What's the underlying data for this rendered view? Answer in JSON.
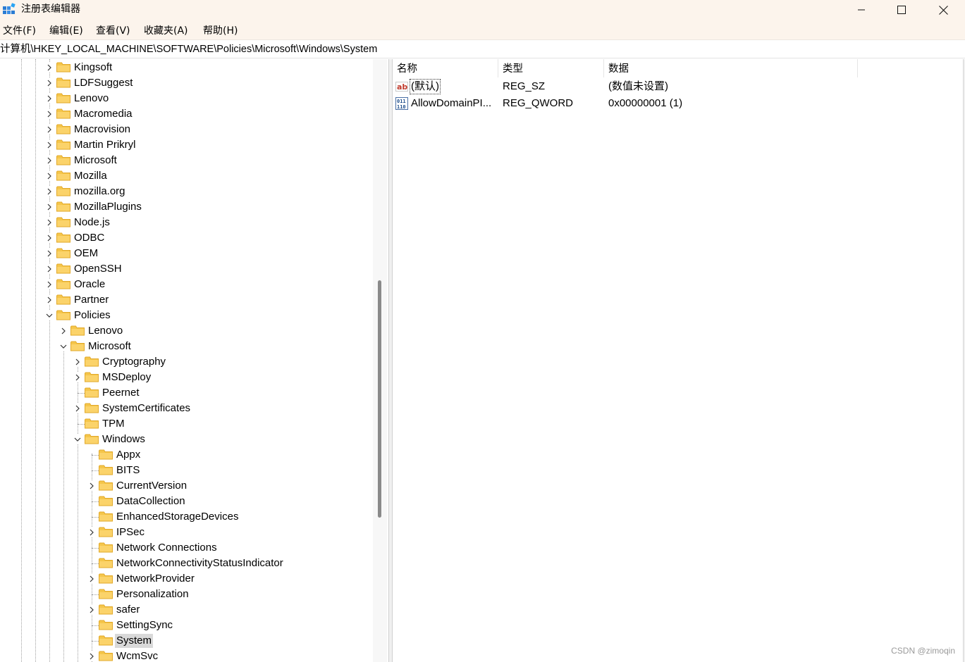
{
  "window": {
    "title": "注册表编辑器",
    "minimize_icon": "minimize-icon",
    "maximize_icon": "maximize-icon",
    "close_icon": "close-icon"
  },
  "menu": [
    "文件(F)",
    "编辑(E)",
    "查看(V)",
    "收藏夹(A)",
    "帮助(H)"
  ],
  "address": "计算机\\HKEY_LOCAL_MACHINE\\SOFTWARE\\Policies\\Microsoft\\Windows\\System",
  "tree": [
    {
      "label": "Kingsoft",
      "level": 0,
      "expander": "collapsed"
    },
    {
      "label": "LDFSuggest",
      "level": 0,
      "expander": "collapsed"
    },
    {
      "label": "Lenovo",
      "level": 0,
      "expander": "collapsed"
    },
    {
      "label": "Macromedia",
      "level": 0,
      "expander": "collapsed"
    },
    {
      "label": "Macrovision",
      "level": 0,
      "expander": "collapsed"
    },
    {
      "label": "Martin Prikryl",
      "level": 0,
      "expander": "collapsed"
    },
    {
      "label": "Microsoft",
      "level": 0,
      "expander": "collapsed"
    },
    {
      "label": "Mozilla",
      "level": 0,
      "expander": "collapsed"
    },
    {
      "label": "mozilla.org",
      "level": 0,
      "expander": "collapsed"
    },
    {
      "label": "MozillaPlugins",
      "level": 0,
      "expander": "collapsed"
    },
    {
      "label": "Node.js",
      "level": 0,
      "expander": "collapsed"
    },
    {
      "label": "ODBC",
      "level": 0,
      "expander": "collapsed"
    },
    {
      "label": "OEM",
      "level": 0,
      "expander": "collapsed"
    },
    {
      "label": "OpenSSH",
      "level": 0,
      "expander": "collapsed"
    },
    {
      "label": "Oracle",
      "level": 0,
      "expander": "collapsed"
    },
    {
      "label": "Partner",
      "level": 0,
      "expander": "collapsed"
    },
    {
      "label": "Policies",
      "level": 0,
      "expander": "expanded"
    },
    {
      "label": "Lenovo",
      "level": 1,
      "expander": "collapsed"
    },
    {
      "label": "Microsoft",
      "level": 1,
      "expander": "expanded"
    },
    {
      "label": "Cryptography",
      "level": 2,
      "expander": "collapsed"
    },
    {
      "label": "MSDeploy",
      "level": 2,
      "expander": "collapsed"
    },
    {
      "label": "Peernet",
      "level": 2,
      "expander": "none"
    },
    {
      "label": "SystemCertificates",
      "level": 2,
      "expander": "collapsed"
    },
    {
      "label": "TPM",
      "level": 2,
      "expander": "none"
    },
    {
      "label": "Windows",
      "level": 2,
      "expander": "expanded"
    },
    {
      "label": "Appx",
      "level": 3,
      "expander": "none"
    },
    {
      "label": "BITS",
      "level": 3,
      "expander": "none"
    },
    {
      "label": "CurrentVersion",
      "level": 3,
      "expander": "collapsed"
    },
    {
      "label": "DataCollection",
      "level": 3,
      "expander": "none"
    },
    {
      "label": "EnhancedStorageDevices",
      "level": 3,
      "expander": "none"
    },
    {
      "label": "IPSec",
      "level": 3,
      "expander": "collapsed"
    },
    {
      "label": "Network Connections",
      "level": 3,
      "expander": "none"
    },
    {
      "label": "NetworkConnectivityStatusIndicator",
      "level": 3,
      "expander": "none"
    },
    {
      "label": "NetworkProvider",
      "level": 3,
      "expander": "collapsed"
    },
    {
      "label": "Personalization",
      "level": 3,
      "expander": "none"
    },
    {
      "label": "safer",
      "level": 3,
      "expander": "collapsed"
    },
    {
      "label": "SettingSync",
      "level": 3,
      "expander": "none"
    },
    {
      "label": "System",
      "level": 3,
      "expander": "none",
      "selected": true
    },
    {
      "label": "WcmSvc",
      "level": 3,
      "expander": "collapsed"
    }
  ],
  "columns": {
    "name": "名称",
    "type": "类型",
    "data": "数据"
  },
  "values": [
    {
      "name": "(默认)",
      "type": "REG_SZ",
      "data": "(数值未设置)",
      "icon": "string-value-icon"
    },
    {
      "name": "AllowDomainPI...",
      "type": "REG_QWORD",
      "data": "0x00000001 (1)",
      "icon": "binary-value-icon"
    }
  ],
  "watermark": "CSDN @zimoqin",
  "colors": {
    "folder": "#f5c64b",
    "folder_dark": "#e2a92a",
    "titlebar": "#fcf4ec",
    "selection": "#d9d9d9"
  }
}
